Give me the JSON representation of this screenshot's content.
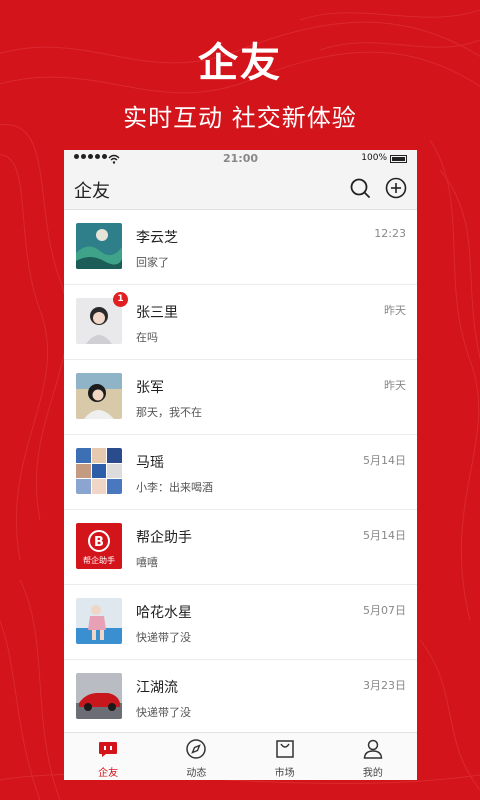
{
  "promo": {
    "title": "企友",
    "subtitle": "实时互动  社交新体验"
  },
  "status_bar": {
    "time": "21:00",
    "battery": "100%"
  },
  "nav": {
    "title": "企友",
    "search_icon": "search-icon",
    "add_icon": "add-circle-icon"
  },
  "conversations": [
    {
      "name": "李云芝",
      "message": "回家了",
      "time": "12:23",
      "badge": "",
      "avatar": "landscape-photo"
    },
    {
      "name": "张三里",
      "message": "在吗",
      "time": "昨天",
      "badge": "1",
      "avatar": "portrait-photo"
    },
    {
      "name": "张军",
      "message": "那天，我不在",
      "time": "昨天",
      "badge": "",
      "avatar": "portrait-photo"
    },
    {
      "name": "马瑶",
      "message": "小李：出来喝酒",
      "time": "5月14日",
      "badge": "",
      "avatar": "group-photo"
    },
    {
      "name": "帮企助手",
      "message": "嘻嘻",
      "time": "5月14日",
      "badge": "",
      "avatar": "assistant-logo",
      "avatar_label": "帮企助手"
    },
    {
      "name": "哈花水星",
      "message": "快递带了没",
      "time": "5月07日",
      "badge": "",
      "avatar": "portrait-photo"
    },
    {
      "name": "江湖流",
      "message": "快递带了没",
      "time": "3月23日",
      "badge": "",
      "avatar": "car-photo"
    }
  ],
  "tabs": [
    {
      "label": "企友",
      "icon": "chat-bubble-icon",
      "active": true
    },
    {
      "label": "动态",
      "icon": "compass-icon",
      "active": false
    },
    {
      "label": "市场",
      "icon": "shopping-bag-icon",
      "active": false
    },
    {
      "label": "我的",
      "icon": "person-icon",
      "active": false
    }
  ],
  "colors": {
    "brand_red": "#d3141b",
    "badge_red": "#e02020"
  }
}
